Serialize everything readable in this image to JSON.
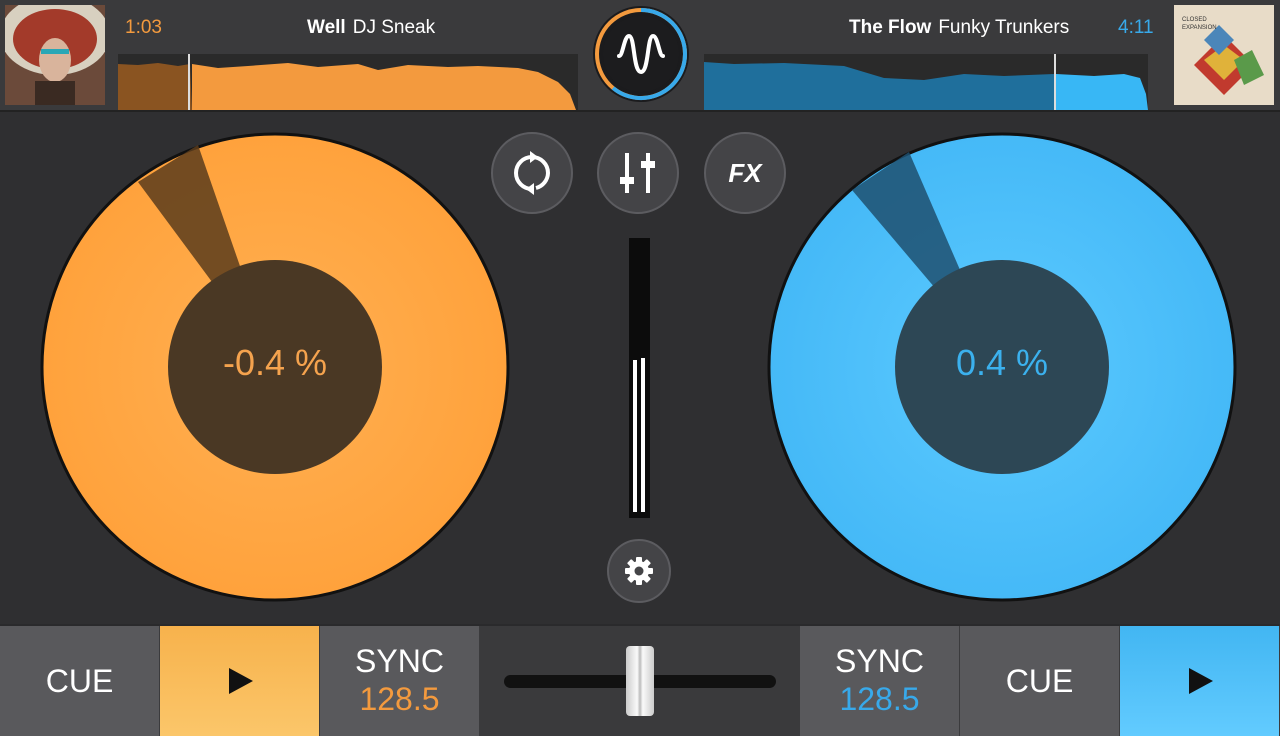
{
  "deck_left": {
    "time": "1:03",
    "title": "Well",
    "artist": "DJ Sneak",
    "pitch": "-0.4 %",
    "cue_label": "CUE",
    "sync_label": "SYNC",
    "bpm": "128.5",
    "color": "#f6a03d",
    "playhead_fraction": 0.15
  },
  "deck_right": {
    "time": "4:11",
    "title": "The Flow",
    "artist": "Funky Trunkers",
    "pitch": "0.4 %",
    "cue_label": "CUE",
    "sync_label": "SYNC",
    "bpm": "128.5",
    "color": "#3db4f2",
    "playhead_fraction": 0.79,
    "cover_text": "CLOSED EXPANSION"
  },
  "center": {
    "fx_label": "FX",
    "crossfader_value": 0.5
  },
  "icons": [
    "app-logo-icon",
    "loop-icon",
    "mixer-icon",
    "gear-icon",
    "play-icon"
  ]
}
